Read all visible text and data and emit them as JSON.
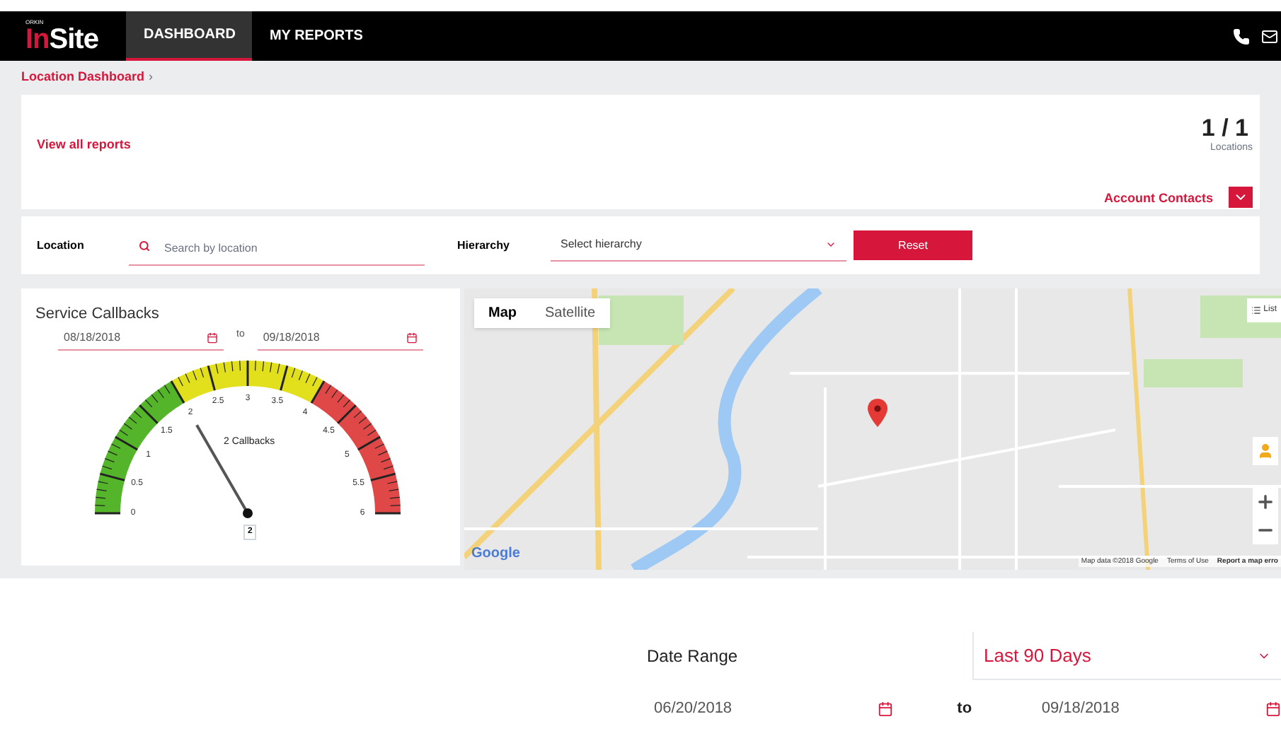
{
  "header": {
    "logo_top": "ORKIN",
    "logo_mark": "In",
    "logo_rest": "Site",
    "nav": [
      {
        "label": "DASHBOARD",
        "selected": true
      },
      {
        "label": "MY REPORTS",
        "selected": false
      }
    ]
  },
  "breadcrumb": {
    "label": "Location Dashboard",
    "separator": "›"
  },
  "summary": {
    "link": "View all reports",
    "count": "1 / 1",
    "count_label": "Locations",
    "contacts": "Account Contacts"
  },
  "filters": {
    "location_label": "Location",
    "location_placeholder": "Search by location",
    "hierarchy_label": "Hierarchy",
    "hierarchy_placeholder": "Select hierarchy",
    "reset": "Reset"
  },
  "callbacks": {
    "title": "Service Callbacks",
    "from": "08/18/2018",
    "to_label": "to",
    "to": "09/18/2018",
    "ticks": [
      "0",
      "0.5",
      "1",
      "1.5",
      "2",
      "2.5",
      "3",
      "3.5",
      "4",
      "4.5",
      "5",
      "5.5",
      "6"
    ],
    "caption": "2 Callbacks",
    "value": "2"
  },
  "map": {
    "tabs": [
      {
        "label": "Map",
        "selected": true
      },
      {
        "label": "Satellite",
        "selected": false
      }
    ],
    "list": "List",
    "logo": "Google",
    "attribution": "Map data ©2018 Google",
    "terms": "Terms of Use",
    "report": "Report a map erro"
  },
  "date_range": {
    "label": "Date Range",
    "value": "Last 90 Days",
    "from": "06/20/2018",
    "to_label": "to",
    "to": "09/18/2018"
  }
}
